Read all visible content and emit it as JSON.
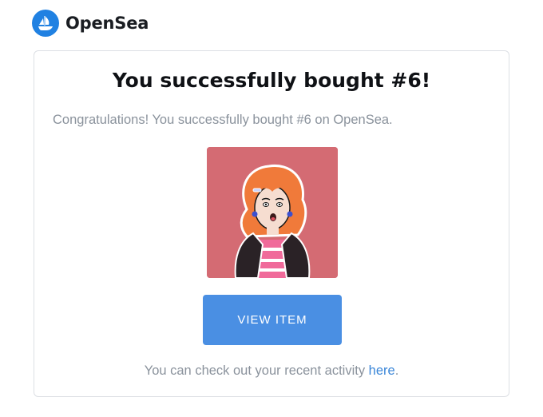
{
  "header": {
    "brand": "OpenSea",
    "logo_icon": "opensea-ship-logo",
    "brand_color": "#2081e2"
  },
  "card": {
    "title": "You successfully bought #6!",
    "message": "Congratulations! You successfully bought #6 on OpenSea.",
    "image": {
      "name": "nft-6-artwork",
      "background_color": "#d46b73"
    },
    "button": {
      "label": "VIEW ITEM",
      "color": "#4a8fe3"
    },
    "footer": {
      "text_before": "You can check out your recent activity ",
      "link_text": "here",
      "text_after": "."
    }
  }
}
